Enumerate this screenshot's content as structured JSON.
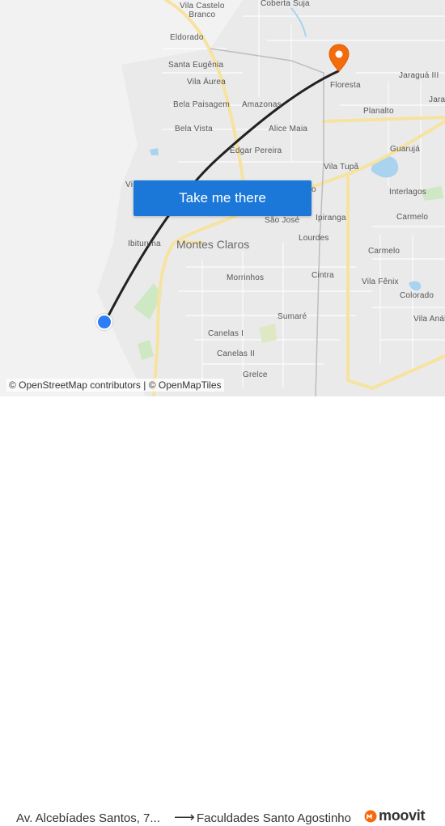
{
  "map": {
    "neighborhoods": [
      {
        "name": "Vila Castelo Branco",
        "lines": [
          "Vila Castelo",
          "Branco"
        ]
      },
      {
        "name": "Coberta Suja",
        "lines": [
          "Coberta Suja"
        ]
      },
      {
        "name": "Eldorado",
        "lines": [
          "Eldorado"
        ]
      },
      {
        "name": "Santa Eugênia",
        "lines": [
          "Santa Eugênia"
        ]
      },
      {
        "name": "Vila Áurea",
        "lines": [
          "Vila Áurea"
        ]
      },
      {
        "name": "Bela Paisagem",
        "lines": [
          "Bela Paisagem"
        ]
      },
      {
        "name": "Amazonas",
        "lines": [
          "Amazonas"
        ]
      },
      {
        "name": "Bela Vista",
        "lines": [
          "Bela Vista"
        ]
      },
      {
        "name": "Alice Maia",
        "lines": [
          "Alice Maia"
        ]
      },
      {
        "name": "Edgar Pereira",
        "lines": [
          "Edgar Pereira"
        ]
      },
      {
        "name": "Floresta",
        "lines": [
          "Floresta"
        ]
      },
      {
        "name": "Jaraguá III",
        "lines": [
          "Jaraguá III"
        ]
      },
      {
        "name": "Planalto",
        "lines": [
          "Planalto"
        ]
      },
      {
        "name": "Jara",
        "lines": [
          "Jara"
        ]
      },
      {
        "name": "Guarujá",
        "lines": [
          "Guarujá"
        ]
      },
      {
        "name": "Vila Tupã",
        "lines": [
          "Vila Tupã"
        ]
      },
      {
        "name": "Interlagos",
        "lines": [
          "Interlagos"
        ]
      },
      {
        "name": "Carmelo",
        "lines": [
          "Carmelo"
        ]
      },
      {
        "name": "Carmelo 2",
        "lines": [
          "Carmelo"
        ]
      },
      {
        "name": "São José",
        "lines": [
          "São José"
        ]
      },
      {
        "name": "Ipiranga",
        "lines": [
          "Ipiranga"
        ]
      },
      {
        "name": "Lourdes",
        "lines": [
          "Lourdes"
        ]
      },
      {
        "name": "Ibituruna",
        "lines": [
          "Ibituruna"
        ]
      },
      {
        "name": "Montes Claros",
        "lines": [
          "Montes Claros"
        ]
      },
      {
        "name": "Morrinhos",
        "lines": [
          "Morrinhos"
        ]
      },
      {
        "name": "Cintra",
        "lines": [
          "Cintra"
        ]
      },
      {
        "name": "Vila Fênix",
        "lines": [
          "Vila Fênix"
        ]
      },
      {
        "name": "Colorado",
        "lines": [
          "Colorado"
        ]
      },
      {
        "name": "Vila Anália",
        "lines": [
          "Vila Análi"
        ]
      },
      {
        "name": "Sumaré",
        "lines": [
          "Sumaré"
        ]
      },
      {
        "name": "Canelas I",
        "lines": [
          "Canelas I"
        ]
      },
      {
        "name": "Canelas II",
        "lines": [
          "Canelas II"
        ]
      },
      {
        "name": "Grelce",
        "lines": [
          "Grelce"
        ]
      },
      {
        "name": "Vi",
        "lines": [
          "Vi"
        ]
      },
      {
        "name": "o",
        "lines": [
          "o"
        ]
      }
    ],
    "cta_label": "Take me there",
    "attribution": {
      "osm_contributors": "© OpenStreetMap contributors",
      "separator": "|",
      "openmaptiles": "© OpenMapTiles"
    },
    "colors": {
      "route": "#222222",
      "origin": "#2e7cf6",
      "destination": "#f46b0d",
      "cta": "#1b78d9",
      "major_road": "#f6e3a0"
    }
  },
  "footer": {
    "from": "Av. Alcebíades Santos, 7...",
    "arrow": "⟶",
    "to": "Faculdades Santo Agostinho",
    "brand": "moovit"
  }
}
